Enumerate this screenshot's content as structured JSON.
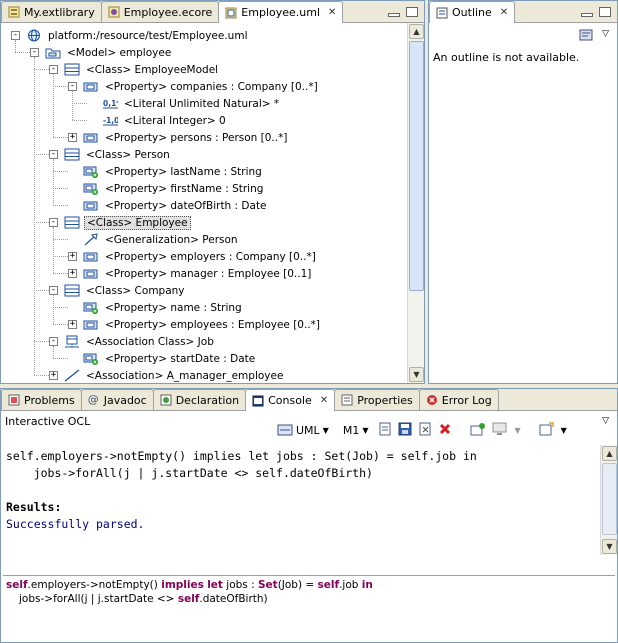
{
  "editor": {
    "tabs": [
      {
        "label": "My.extlibrary",
        "active": false
      },
      {
        "label": "Employee.ecore",
        "active": false
      },
      {
        "label": "Employee.uml",
        "active": true
      }
    ],
    "close_symbol": "✕"
  },
  "tree": {
    "rows": [
      {
        "text": "platform:/resource/test/Employee.uml",
        "icon": "resource-icon",
        "toggle": "-"
      },
      {
        "text": "<Model> employee",
        "icon": "model-icon",
        "toggle": "-"
      },
      {
        "text": "<Class> EmployeeModel",
        "icon": "class-icon",
        "toggle": "-"
      },
      {
        "text": "<Property> companies : Company [0..*]",
        "icon": "property-icon",
        "toggle": "-"
      },
      {
        "text": "<Literal Unlimited Natural> *",
        "icon": "literal-unlimited-icon",
        "toggle": ""
      },
      {
        "text": "<Literal Integer> 0",
        "icon": "literal-integer-icon",
        "toggle": ""
      },
      {
        "text": "<Property> persons : Person [0..*]",
        "icon": "property-icon",
        "toggle": "+"
      },
      {
        "text": "<Class> Person",
        "icon": "class-icon",
        "toggle": "-"
      },
      {
        "text": "<Property> lastName : String",
        "icon": "property-green-icon",
        "toggle": ""
      },
      {
        "text": "<Property> firstName : String",
        "icon": "property-green-icon",
        "toggle": ""
      },
      {
        "text": "<Property> dateOfBirth : Date",
        "icon": "property-icon",
        "toggle": ""
      },
      {
        "text": "<Class> Employee",
        "icon": "class-icon",
        "toggle": "-",
        "selected": true
      },
      {
        "text": "<Generalization> Person",
        "icon": "generalization-icon",
        "toggle": ""
      },
      {
        "text": "<Property> employers : Company [0..*]",
        "icon": "property-icon",
        "toggle": "+"
      },
      {
        "text": "<Property> manager : Employee [0..1]",
        "icon": "property-icon",
        "toggle": "+"
      },
      {
        "text": "<Class> Company",
        "icon": "class-icon",
        "toggle": "-"
      },
      {
        "text": "<Property> name : String",
        "icon": "property-green-icon",
        "toggle": ""
      },
      {
        "text": "<Property> employees : Employee [0..*]",
        "icon": "property-icon",
        "toggle": "+"
      },
      {
        "text": "<Association Class> Job",
        "icon": "association-class-icon",
        "toggle": "-"
      },
      {
        "text": "<Property> startDate : Date",
        "icon": "property-green-icon",
        "toggle": ""
      },
      {
        "text": "<Association> A_manager_employee",
        "icon": "association-icon",
        "toggle": "+"
      }
    ]
  },
  "outline": {
    "tab_label": "Outline",
    "message": "An outline is not available."
  },
  "console": {
    "tabs": [
      {
        "label": "Problems",
        "active": false
      },
      {
        "label": "Javadoc",
        "active": false
      },
      {
        "label": "Declaration",
        "active": false
      },
      {
        "label": "Console",
        "active": true
      },
      {
        "label": "Properties",
        "active": false
      },
      {
        "label": "Error Log",
        "active": false
      }
    ],
    "title": "Interactive OCL",
    "metamodel_label": "UML",
    "level_label": "M1",
    "output_line1": "self.employers->notEmpty() implies let jobs : Set(Job) = self.job in",
    "output_line2": "    jobs->forAll(j | j.startDate <> self.dateOfBirth)",
    "results_label": "Results:",
    "result_text": "Successfully parsed.",
    "input": {
      "l1_self": "self",
      "l1_a": ".employers->notEmpty() ",
      "l1_implies": "implies",
      "l1_b": " ",
      "l1_let": "let",
      "l1_c": " jobs : ",
      "l1_set": "Set",
      "l1_d": "(Job) = ",
      "l1_self2": "self",
      "l1_e": ".job ",
      "l1_in": "in",
      "l2_a": "jobs->forAll(j | j.startDate <> ",
      "l2_self": "self",
      "l2_b": ".dateOfBirth)"
    }
  }
}
